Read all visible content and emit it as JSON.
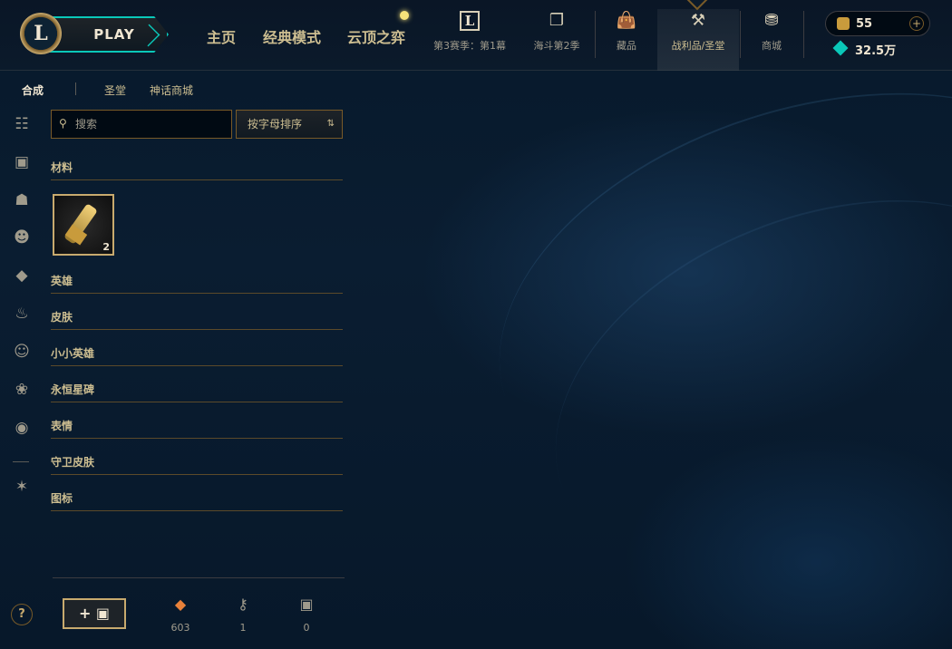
{
  "topnav": {
    "logo_letter": "L",
    "play_label": "PLAY",
    "main_items": [
      "主页",
      "经典模式",
      "云顶之弈"
    ],
    "season_letter": "L",
    "sub_items": [
      {
        "label": "第3赛季：第1幕",
        "icon": "season-pass-icon"
      },
      {
        "label": "海斗第2季",
        "icon": "cards-icon"
      },
      {
        "label": "藏品",
        "icon": "backpack-icon"
      },
      {
        "label": "战利品/圣堂",
        "icon": "crafting-hammer-icon"
      },
      {
        "label": "商城",
        "icon": "coins-stack-icon"
      }
    ],
    "active_item": "战利品/圣堂"
  },
  "wallet": {
    "rp_value": "55",
    "rp_plus": "+",
    "be_value": "32.5万"
  },
  "subtabs": [
    "合成",
    "圣堂",
    "神话商城"
  ],
  "active_subtab": "合成",
  "search": {
    "placeholder": "搜索",
    "value": ""
  },
  "sort": {
    "selected": "按字母排序"
  },
  "sections": [
    "材料",
    "英雄",
    "皮肤",
    "小小英雄",
    "永恒星碑",
    "表情",
    "守卫皮肤",
    "图标"
  ],
  "materials": [
    {
      "name": "hextech-key",
      "count": "2",
      "icon": "key-icon"
    }
  ],
  "rail_icons": [
    "grid-icon",
    "chest-icon",
    "helmet-icon",
    "mask-icon",
    "champion-shard-icon",
    "fire-icon",
    "emote-face-icon",
    "tiny-legend-icon",
    "avatar-icon",
    "ward-icon"
  ],
  "help_label": "?",
  "bottom": {
    "craft_label": "+",
    "orange_essence": "603",
    "keys": "1",
    "chests": "0"
  },
  "colors": {
    "gold": "#c8aa6e",
    "teal": "#0ac8b9",
    "background": "#0a1d31"
  }
}
